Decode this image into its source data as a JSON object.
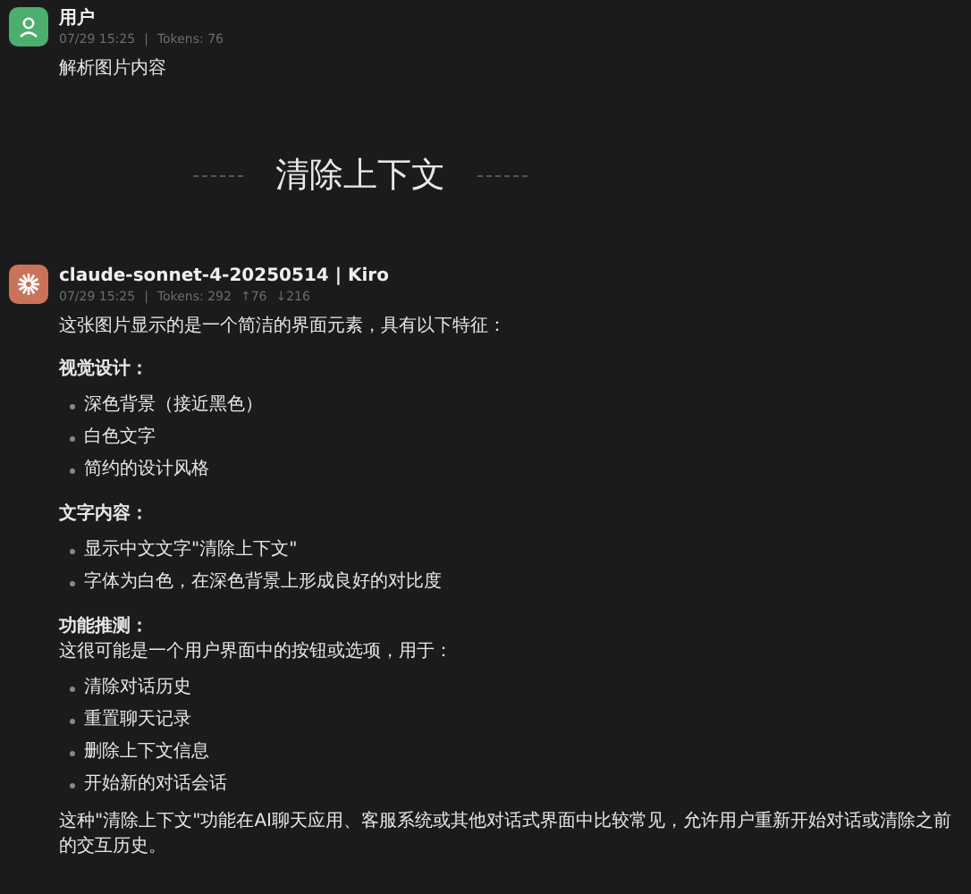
{
  "messages": [
    {
      "kind": "user",
      "name": "用户",
      "time": "07/29 15:25",
      "separator": "|",
      "tokens": [
        "Tokens: 76"
      ],
      "content": [
        {
          "kind": "paragraph",
          "text": "解析图片内容"
        }
      ]
    },
    {
      "kind": "divider",
      "text": "清除上下文"
    },
    {
      "kind": "assistant",
      "name": "claude-sonnet-4-20250514 | Kiro",
      "time": "07/29 15:25",
      "separator": "|",
      "tokens": [
        "Tokens: 292",
        "↑76",
        "↓216"
      ],
      "content": [
        {
          "kind": "paragraph",
          "text": "这张图片显示的是一个简洁的界面元素，具有以下特征："
        },
        {
          "kind": "heading",
          "text": "视觉设计："
        },
        {
          "kind": "list",
          "items": [
            "深色背景（接近黑色）",
            "白色文字",
            "简约的设计风格"
          ]
        },
        {
          "kind": "heading",
          "text": "文字内容："
        },
        {
          "kind": "list",
          "items": [
            "显示中文文字\"清除上下文\"",
            "字体为白色，在深色背景上形成良好的对比度"
          ]
        },
        {
          "kind": "heading",
          "text": "功能推测："
        },
        {
          "kind": "paragraph",
          "text": "这很可能是一个用户界面中的按钮或选项，用于："
        },
        {
          "kind": "list",
          "items": [
            "清除对话历史",
            "重置聊天记录",
            "删除上下文信息",
            "开始新的对话会话"
          ]
        },
        {
          "kind": "paragraph",
          "text": "这种\"清除上下文\"功能在AI聊天应用、客服系统或其他对话式界面中比较常见，允许用户重新开始对话或清除之前的交互历史。"
        }
      ]
    }
  ]
}
